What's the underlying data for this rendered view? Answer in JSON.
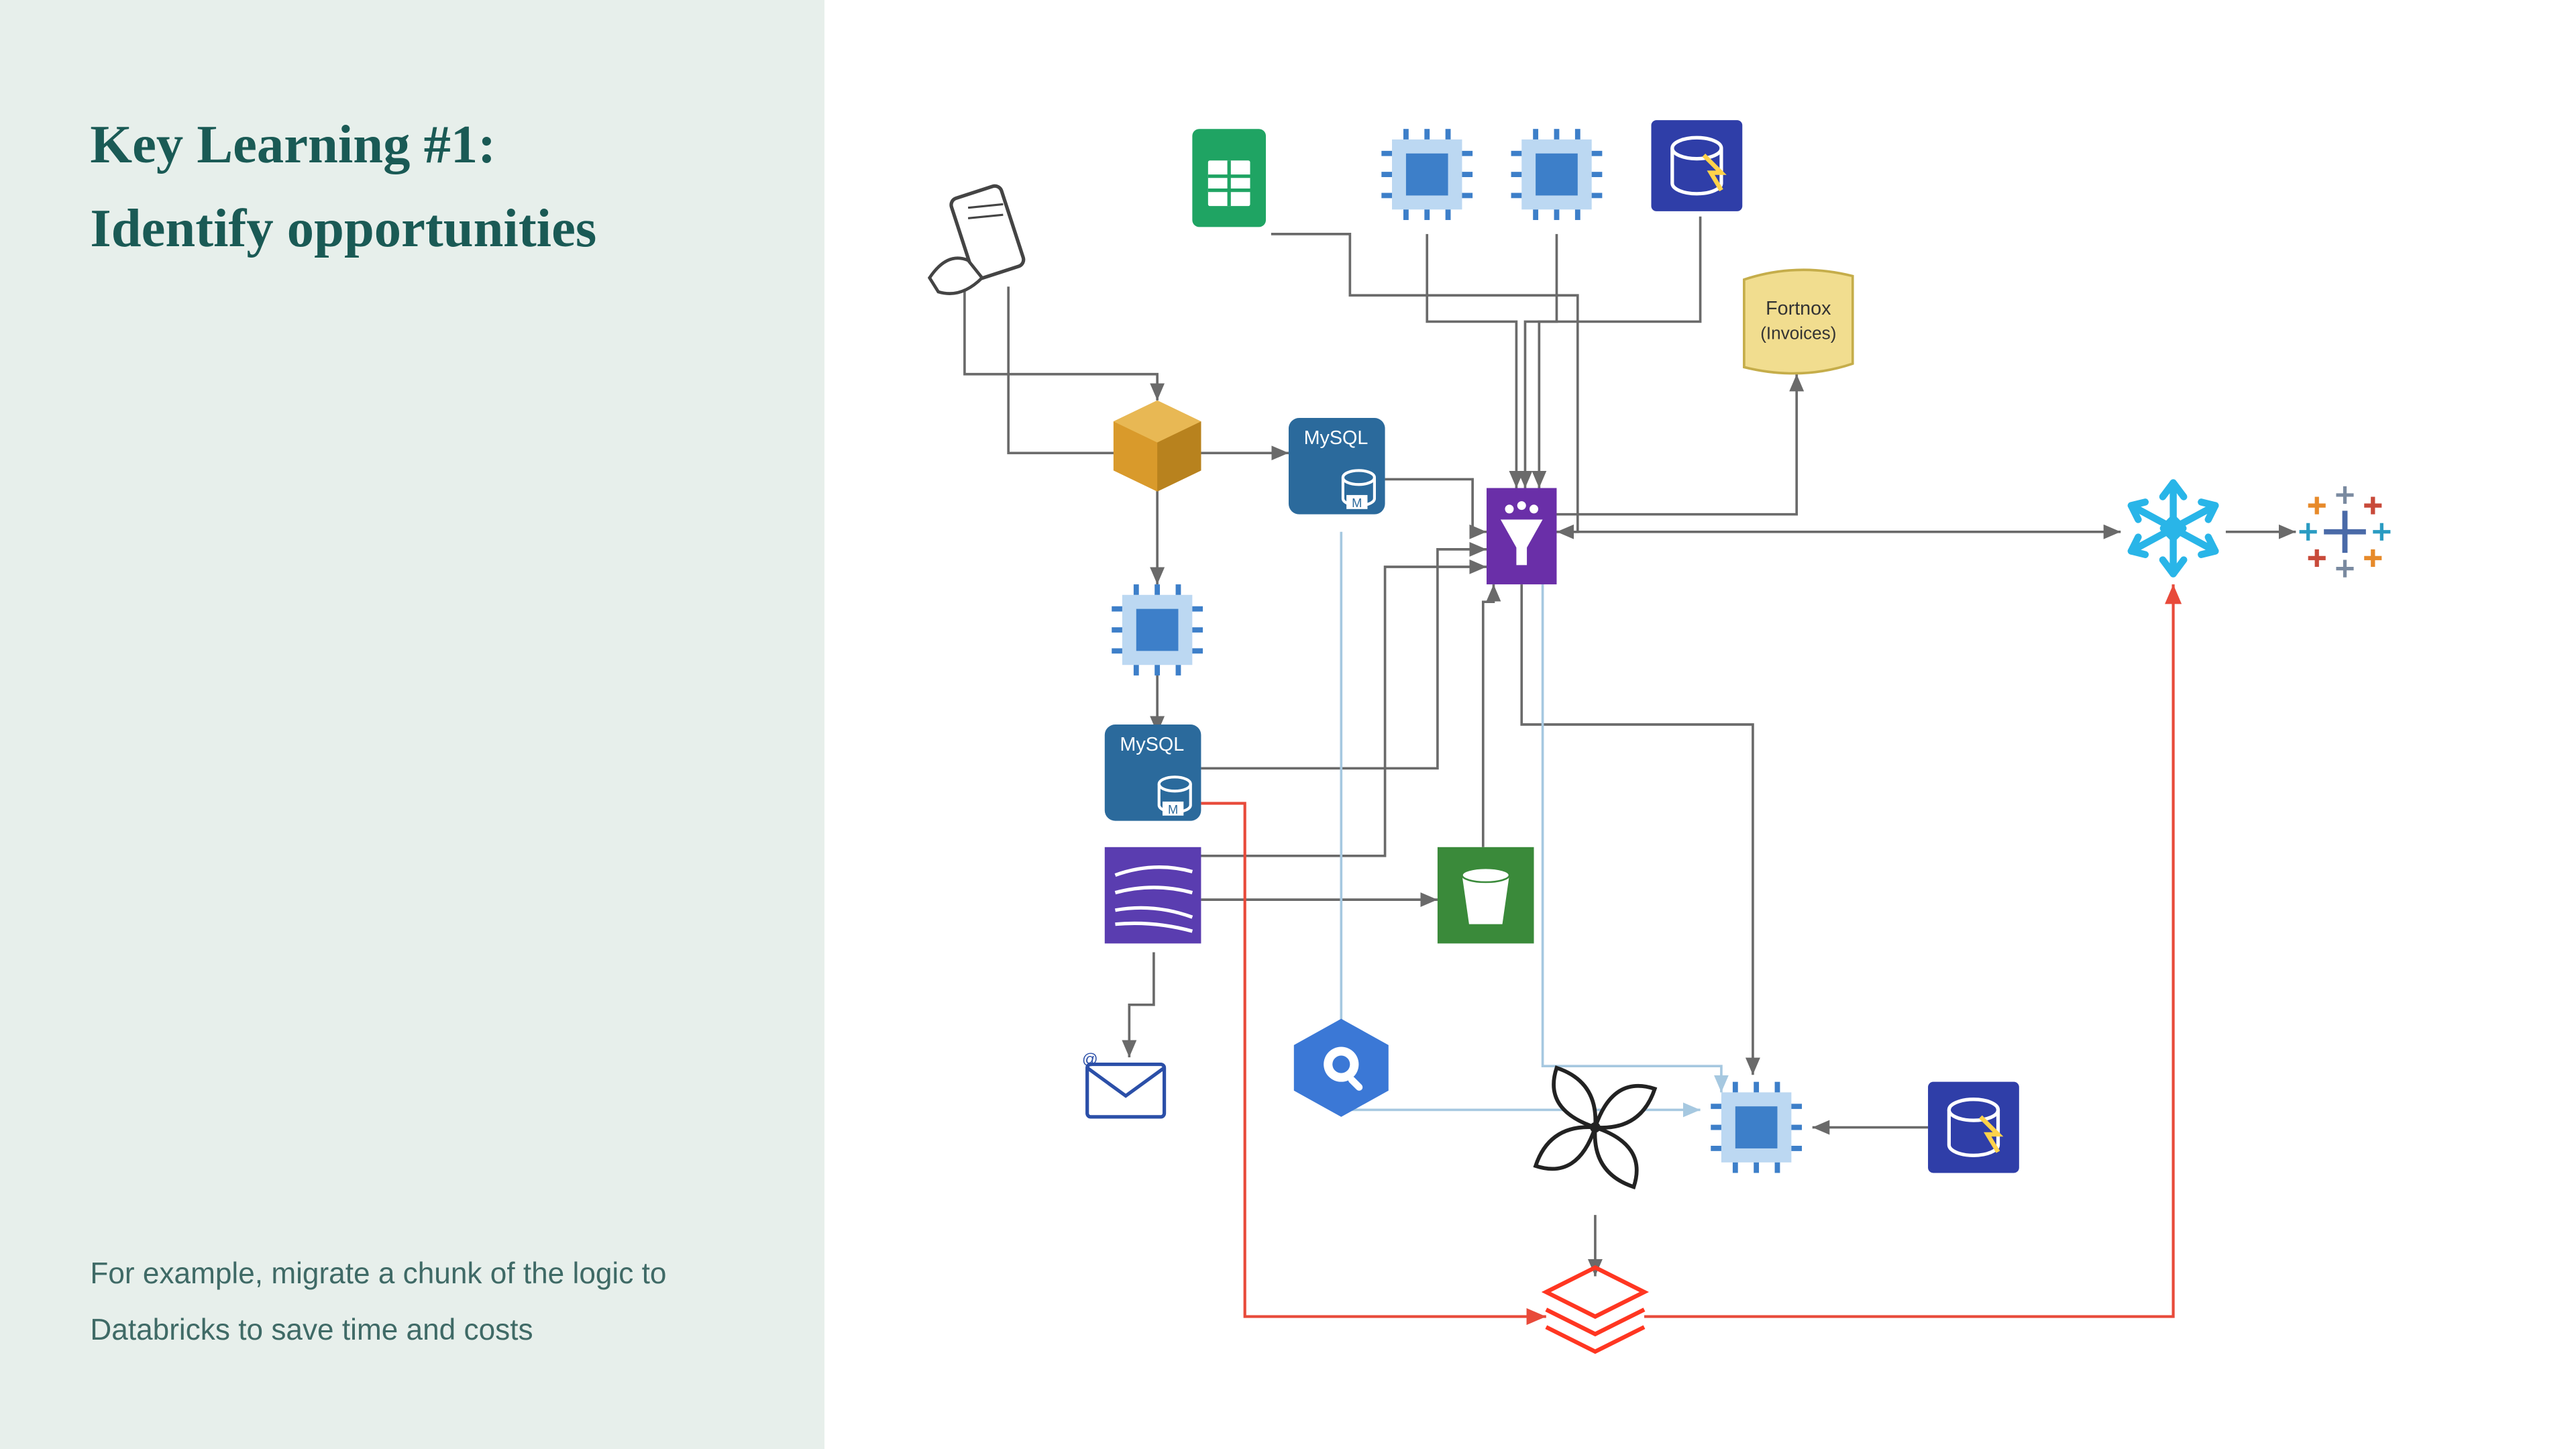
{
  "title_line1": "Key Learning #1:",
  "title_line2": "Identify opportunities",
  "footer_text": "For example, migrate a chunk of the logic to Databricks to save time and costs",
  "nodes": {
    "handheld": "Handheld device input",
    "sheets": "Spreadsheet",
    "chip1": "Compute process 1",
    "chip2": "Compute process 2",
    "dynamo1": "Database service",
    "fortnox_line1": "Fortnox",
    "fortnox_line2": "(Invoices)",
    "lambda": "Serverless function",
    "mysql1_label": "MySQL",
    "mysql2_label": "MySQL",
    "chip3": "Compute process 3",
    "funnel": "Data funnel / ETL",
    "kinesis": "Streaming service",
    "s3": "Object storage bucket",
    "email": "Email",
    "bigquery": "BigQuery",
    "airflow": "Airflow / orchestration",
    "chip4": "Compute process 4",
    "dynamo2": "Database service 2",
    "databricks": "Databricks",
    "snowflake": "Snowflake",
    "tableau": "Tableau"
  },
  "colors": {
    "panel_bg": "#e7efeb",
    "title": "#1a5a55",
    "footer": "#3f6a66",
    "arrow_grey": "#6a6a6a",
    "arrow_blue": "#a6c8e0",
    "arrow_red": "#e84a3a",
    "sheets_green": "#1fa463",
    "chip_blue": "#3d7fc9",
    "chip_light": "#bcd8f2",
    "dynamo_blue": "#2f3ea8",
    "fortnox_bg": "#f1dd8f",
    "fortnox_border": "#c5ad4a",
    "lambda_orange": "#d99a2b",
    "mysql_bg": "#2b6a9c",
    "funnel_bg": "#6a2fa8",
    "kinesis_bg": "#5a3db0",
    "s3_bg": "#3a8a3a",
    "bigquery_bg": "#3b78d6",
    "snowflake": "#29b5e8",
    "databricks": "#ff3621"
  }
}
